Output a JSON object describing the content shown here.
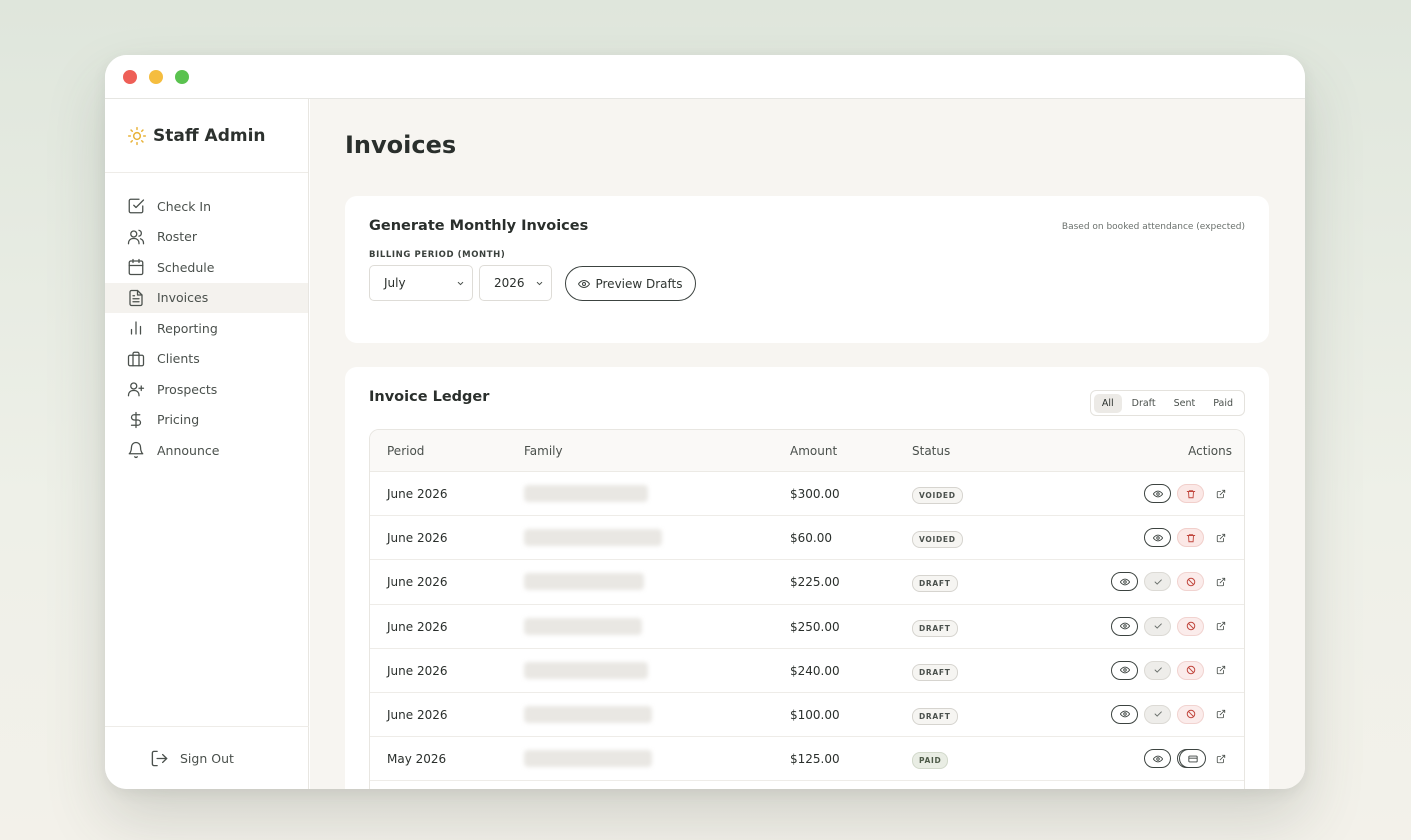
{
  "app": {
    "brand": "Staff Admin",
    "accent_color": "#e8b33a"
  },
  "sidebar": {
    "items": [
      {
        "label": "Check In",
        "icon": "check-square-icon"
      },
      {
        "label": "Roster",
        "icon": "users-icon"
      },
      {
        "label": "Schedule",
        "icon": "calendar-icon"
      },
      {
        "label": "Invoices",
        "icon": "file-text-icon",
        "active": true
      },
      {
        "label": "Reporting",
        "icon": "bar-chart-icon"
      },
      {
        "label": "Clients",
        "icon": "briefcase-icon"
      },
      {
        "label": "Prospects",
        "icon": "user-plus-icon"
      },
      {
        "label": "Pricing",
        "icon": "dollar-icon"
      },
      {
        "label": "Announce",
        "icon": "bell-icon"
      }
    ],
    "sign_out": "Sign Out"
  },
  "page": {
    "title": "Invoices"
  },
  "generate": {
    "title": "Generate Monthly Invoices",
    "note": "Based on booked attendance (expected)",
    "period_label": "BILLING PERIOD (MONTH)",
    "month": "July",
    "year": "2026",
    "preview_label": "Preview Drafts"
  },
  "ledger": {
    "title": "Invoice Ledger",
    "filters": [
      "All",
      "Draft",
      "Sent",
      "Paid"
    ],
    "active_filter": "All",
    "columns": {
      "period": "Period",
      "family": "Family",
      "amount": "Amount",
      "status": "Status",
      "actions": "Actions"
    },
    "rows": [
      {
        "period": "June 2026",
        "amount": "$300.00",
        "status": "VOIDED"
      },
      {
        "period": "June 2026",
        "amount": "$60.00",
        "status": "VOIDED"
      },
      {
        "period": "June 2026",
        "amount": "$225.00",
        "status": "DRAFT"
      },
      {
        "period": "June 2026",
        "amount": "$250.00",
        "status": "DRAFT"
      },
      {
        "period": "June 2026",
        "amount": "$240.00",
        "status": "DRAFT"
      },
      {
        "period": "June 2026",
        "amount": "$100.00",
        "status": "DRAFT"
      },
      {
        "period": "May 2026",
        "amount": "$125.00",
        "status": "PAID"
      }
    ]
  }
}
